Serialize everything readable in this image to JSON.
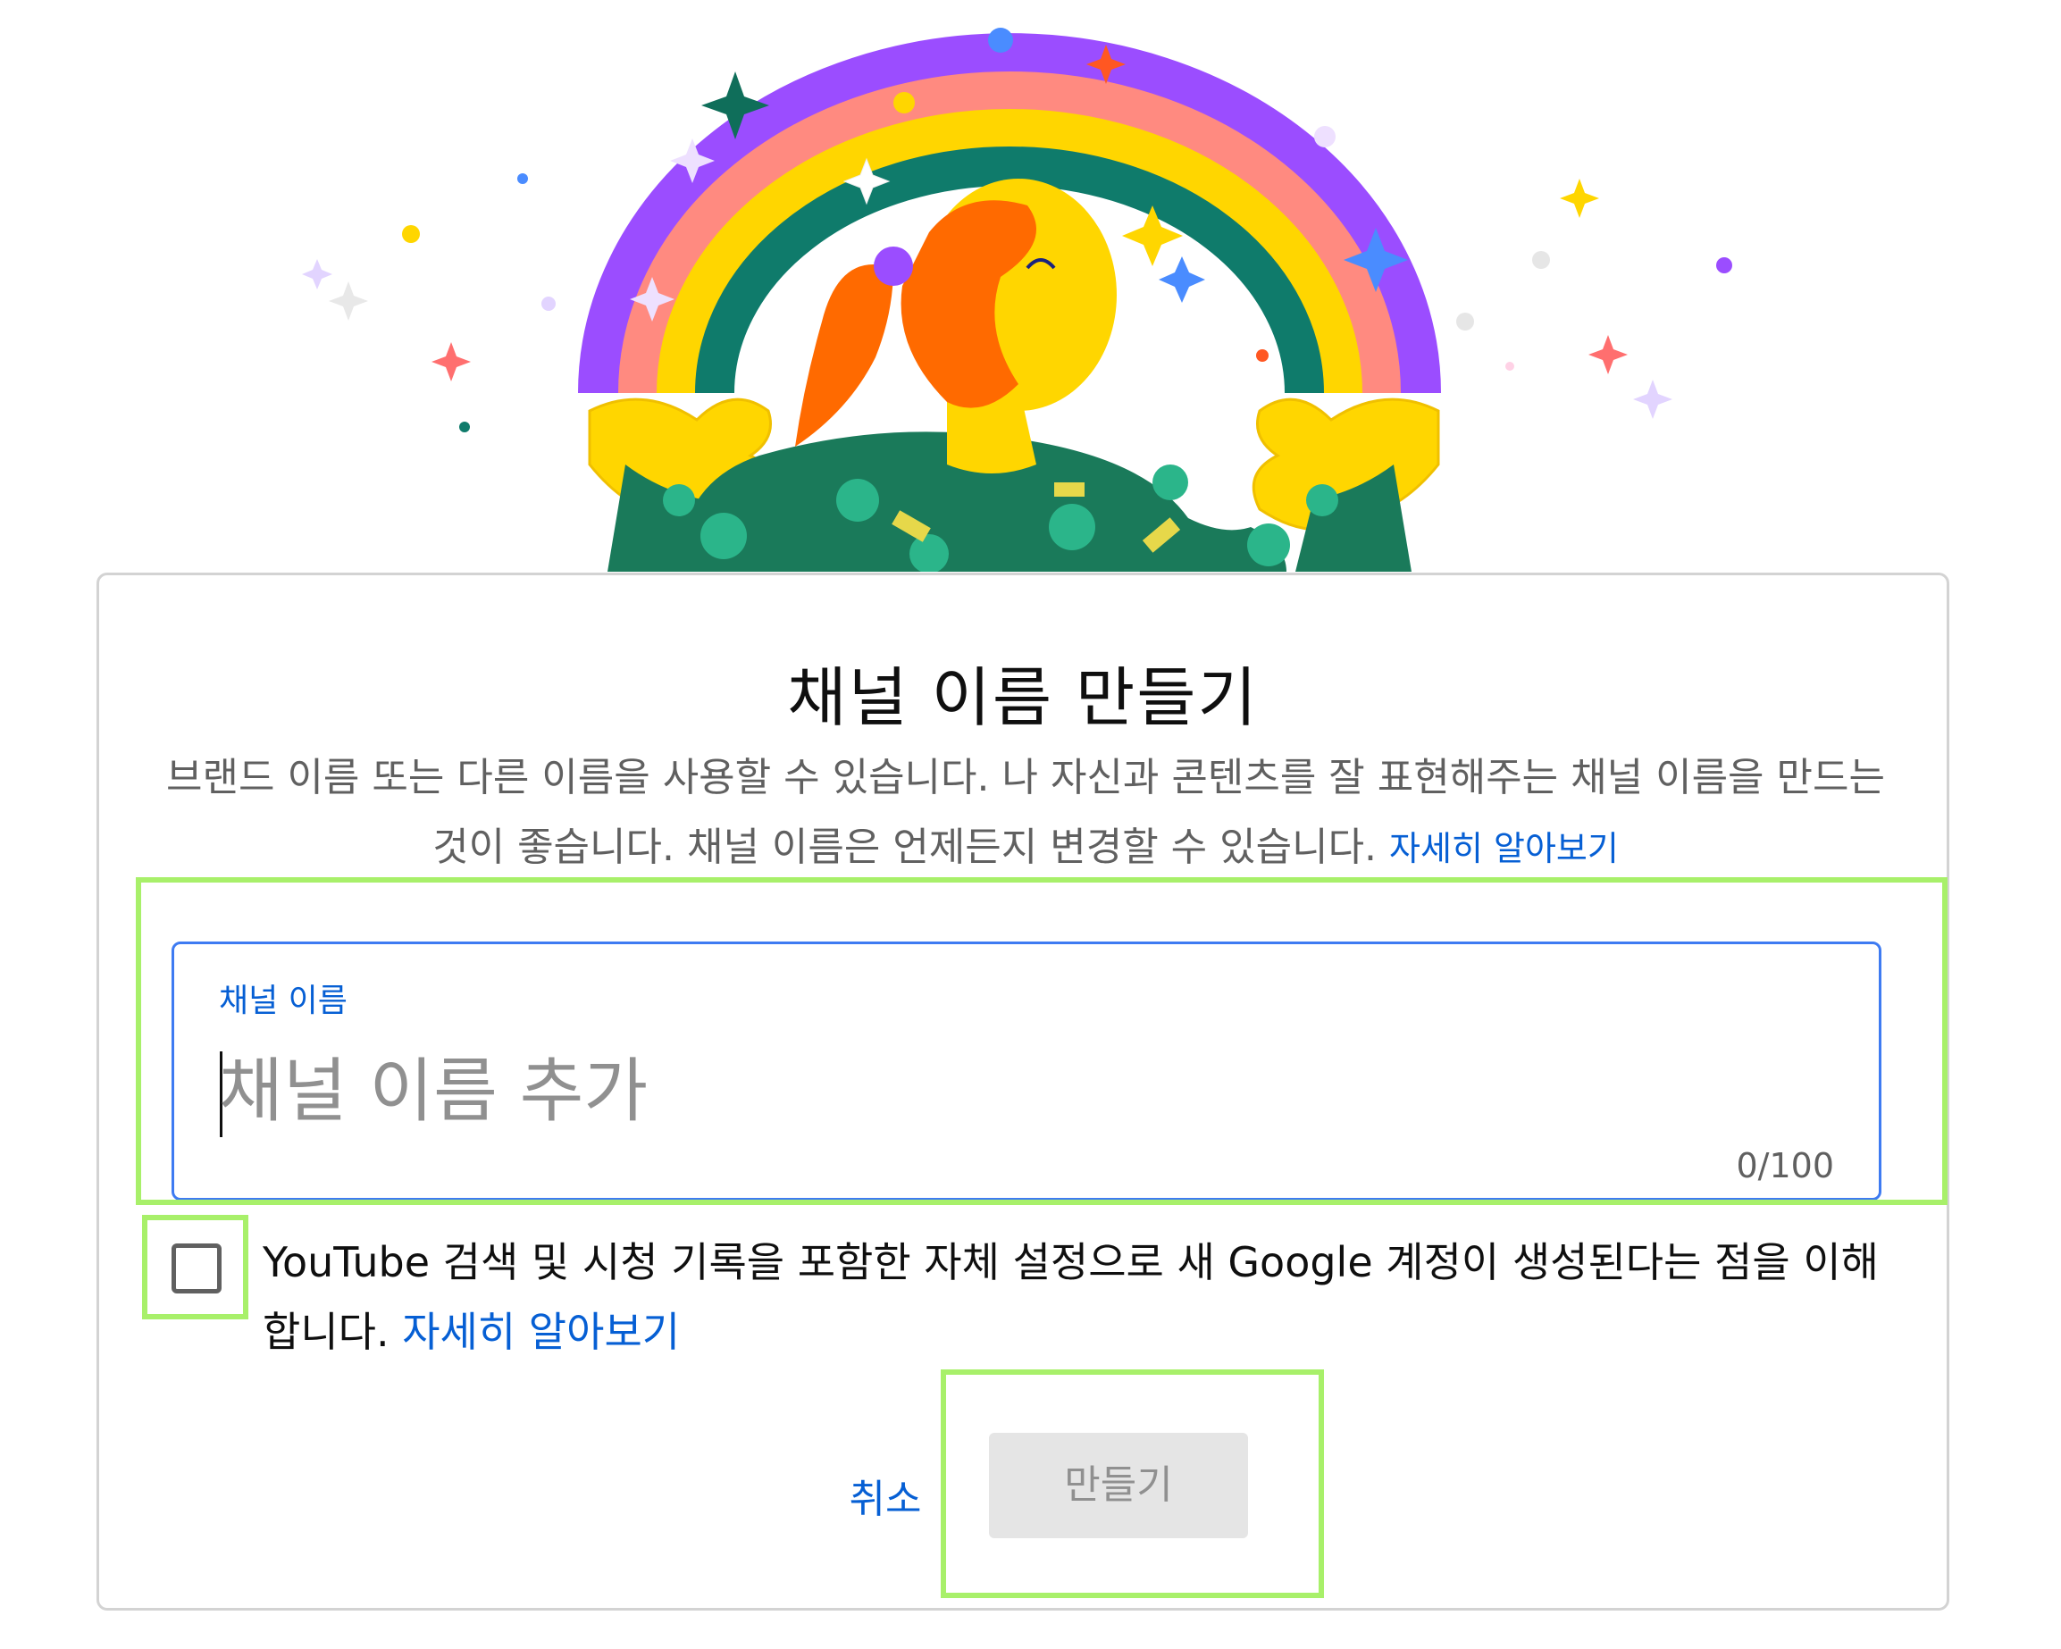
{
  "dialog": {
    "title": "채널 이름 만들기",
    "description": "브랜드 이름 또는 다른 이름을 사용할 수 있습니다. 나 자신과 콘텐츠를 잘 표현해주는 채널 이름을 만드는 것이 좋습니다. 채널 이름은 언제든지 변경할 수 있습니다.",
    "description_link": "자세히 알아보기"
  },
  "channel_name_field": {
    "label": "채널 이름",
    "value": "",
    "placeholder": "채널 이름 추가",
    "counter": "0/100"
  },
  "agreement": {
    "checked": false,
    "text": "YouTube 검색 및 시청 기록을 포함한 자체 설정으로 새 Google 계정이 생성된다는 점을 이해합니다.",
    "link": "자세히 알아보기"
  },
  "actions": {
    "cancel_label": "취소",
    "create_label": "만들기",
    "create_enabled": false
  },
  "colors": {
    "accent_blue": "#065fd4",
    "focus_border": "#3e7bf2",
    "highlight_green": "#a8f06a",
    "disabled_button_bg": "#e5e5e5"
  }
}
